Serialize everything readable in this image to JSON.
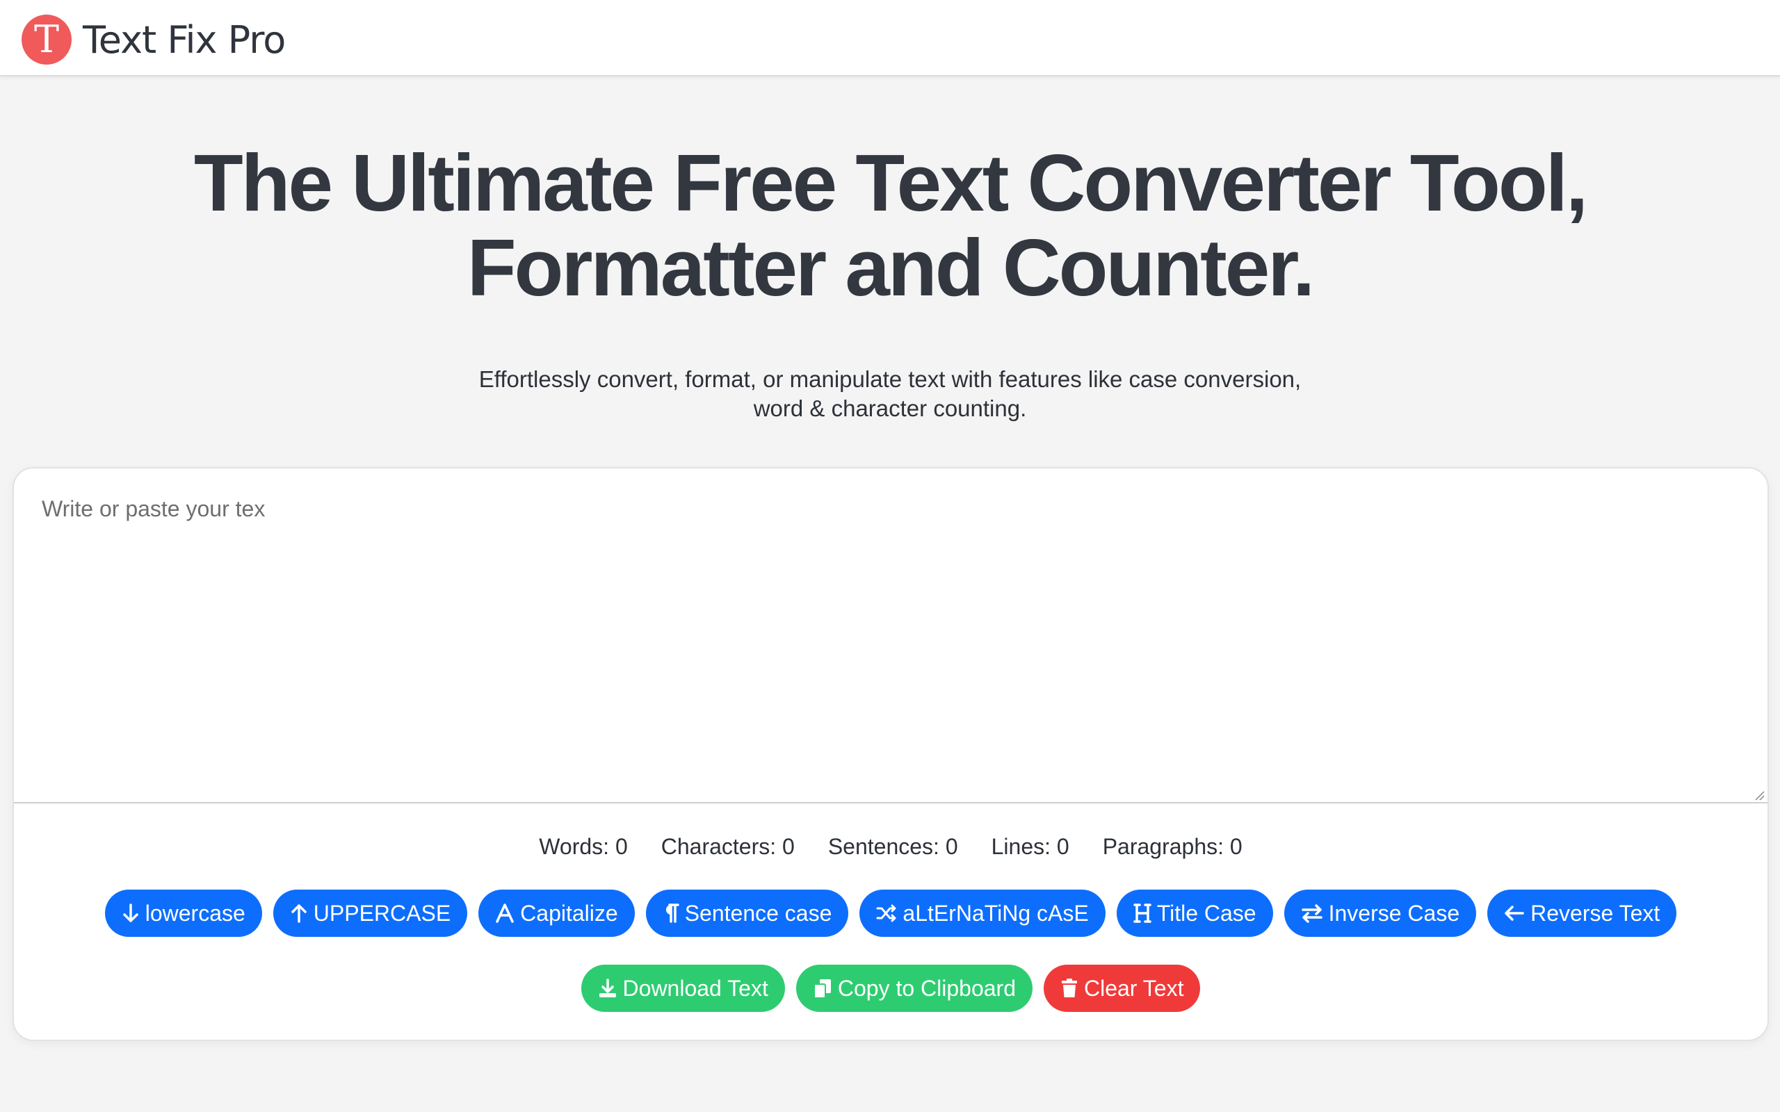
{
  "header": {
    "logo_letter": "T",
    "brand_name": "Text Fix Pro"
  },
  "hero": {
    "title_line1": "The Ultimate Free Text Converter Tool,",
    "title_line2": "Formatter and Counter.",
    "subtitle_line1": "Effortlessly convert, format, or manipulate text with features like case conversion,",
    "subtitle_line2": "word & character counting."
  },
  "editor": {
    "placeholder": "Write or paste your tex",
    "value": ""
  },
  "stats": {
    "words": "Words: 0",
    "characters": "Characters: 0",
    "sentences": "Sentences: 0",
    "lines": "Lines: 0",
    "paragraphs": "Paragraphs: 0"
  },
  "case_buttons": {
    "lowercase": {
      "label": "lowercase",
      "icon": "arrow-down-icon"
    },
    "uppercase": {
      "label": "UPPERCASE",
      "icon": "arrow-up-icon"
    },
    "capitalize": {
      "label": "Capitalize",
      "icon": "font-a-icon"
    },
    "sentence_case": {
      "label": "Sentence case",
      "icon": "paragraph-icon"
    },
    "alternating_case": {
      "label": "aLtErNaTiNg cAsE",
      "icon": "shuffle-icon"
    },
    "title_case": {
      "label": "Title Case",
      "icon": "heading-icon"
    },
    "inverse_case": {
      "label": "Inverse Case",
      "icon": "swap-arrows-icon"
    },
    "reverse_text": {
      "label": "Reverse Text",
      "icon": "arrow-left-icon"
    }
  },
  "action_buttons": {
    "download": {
      "label": "Download Text",
      "icon": "download-icon"
    },
    "copy": {
      "label": "Copy to Clipboard",
      "icon": "copy-icon"
    },
    "clear": {
      "label": "Clear Text",
      "icon": "trash-icon"
    }
  },
  "colors": {
    "primary_blue": "#0d6efd",
    "success_green": "#2ecc71",
    "danger_red": "#f03a3a",
    "logo_red": "#f05a5a",
    "page_background": "#f4f4f4"
  }
}
